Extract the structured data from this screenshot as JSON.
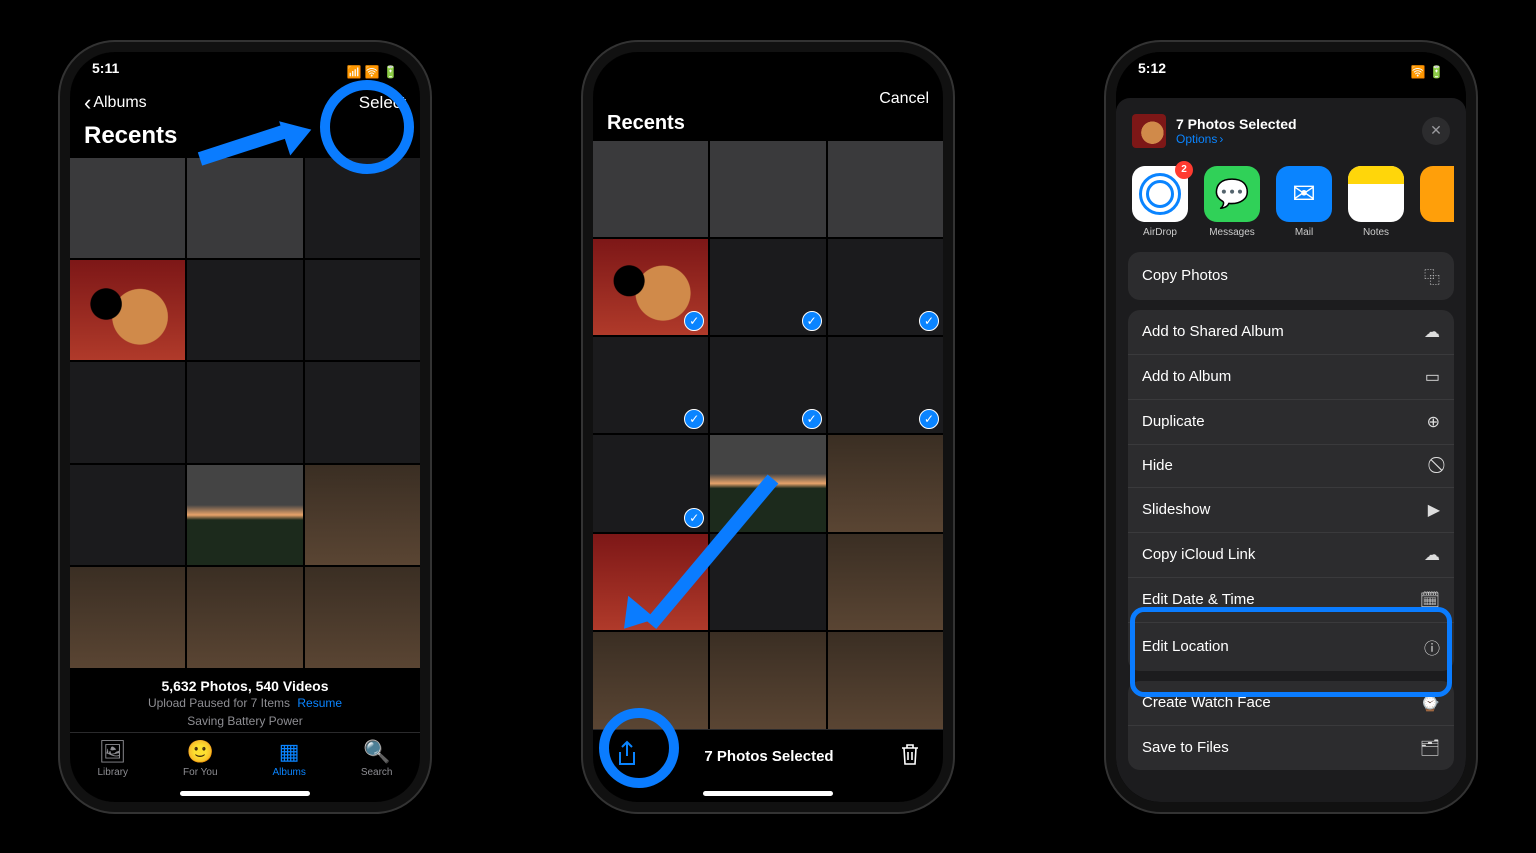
{
  "phone1": {
    "time": "5:11",
    "back_label": "Albums",
    "select_label": "Select",
    "title": "Recents",
    "footer_count": "5,632 Photos, 540 Videos",
    "footer_upload": "Upload Paused for 7 Items",
    "footer_resume": "Resume",
    "footer_battery": "Saving Battery Power",
    "tabs": [
      {
        "label": "Library",
        "icon": "🖼"
      },
      {
        "label": "For You",
        "icon": "🙂"
      },
      {
        "label": "Albums",
        "icon": "▦"
      },
      {
        "label": "Search",
        "icon": "🔍"
      }
    ],
    "active_tab": 2
  },
  "phone2": {
    "cancel_label": "Cancel",
    "title": "Recents",
    "selected_label": "7 Photos Selected"
  },
  "phone3": {
    "time": "5:12",
    "sheet_title": "7 Photos Selected",
    "options_label": "Options",
    "airdrop_badge": "2",
    "share_apps": [
      {
        "label": "AirDrop",
        "key": "airdrop"
      },
      {
        "label": "Messages",
        "key": "msg"
      },
      {
        "label": "Mail",
        "key": "mail"
      },
      {
        "label": "Notes",
        "key": "notes"
      }
    ],
    "actions_g1": [
      {
        "label": "Copy Photos",
        "icon": "⿻"
      }
    ],
    "actions_g2": [
      {
        "label": "Add to Shared Album",
        "icon": "☁"
      },
      {
        "label": "Add to Album",
        "icon": "▭"
      },
      {
        "label": "Duplicate",
        "icon": "⊕"
      },
      {
        "label": "Hide",
        "icon": "⃠"
      },
      {
        "label": "Slideshow",
        "icon": "▶"
      },
      {
        "label": "Copy iCloud Link",
        "icon": "☁"
      },
      {
        "label": "Edit Date & Time",
        "icon": "🗓"
      },
      {
        "label": "Edit Location",
        "icon": "ⓘ"
      }
    ],
    "actions_g3": [
      {
        "label": "Create Watch Face",
        "icon": "⌚"
      },
      {
        "label": "Save to Files",
        "icon": "🗂"
      }
    ]
  }
}
